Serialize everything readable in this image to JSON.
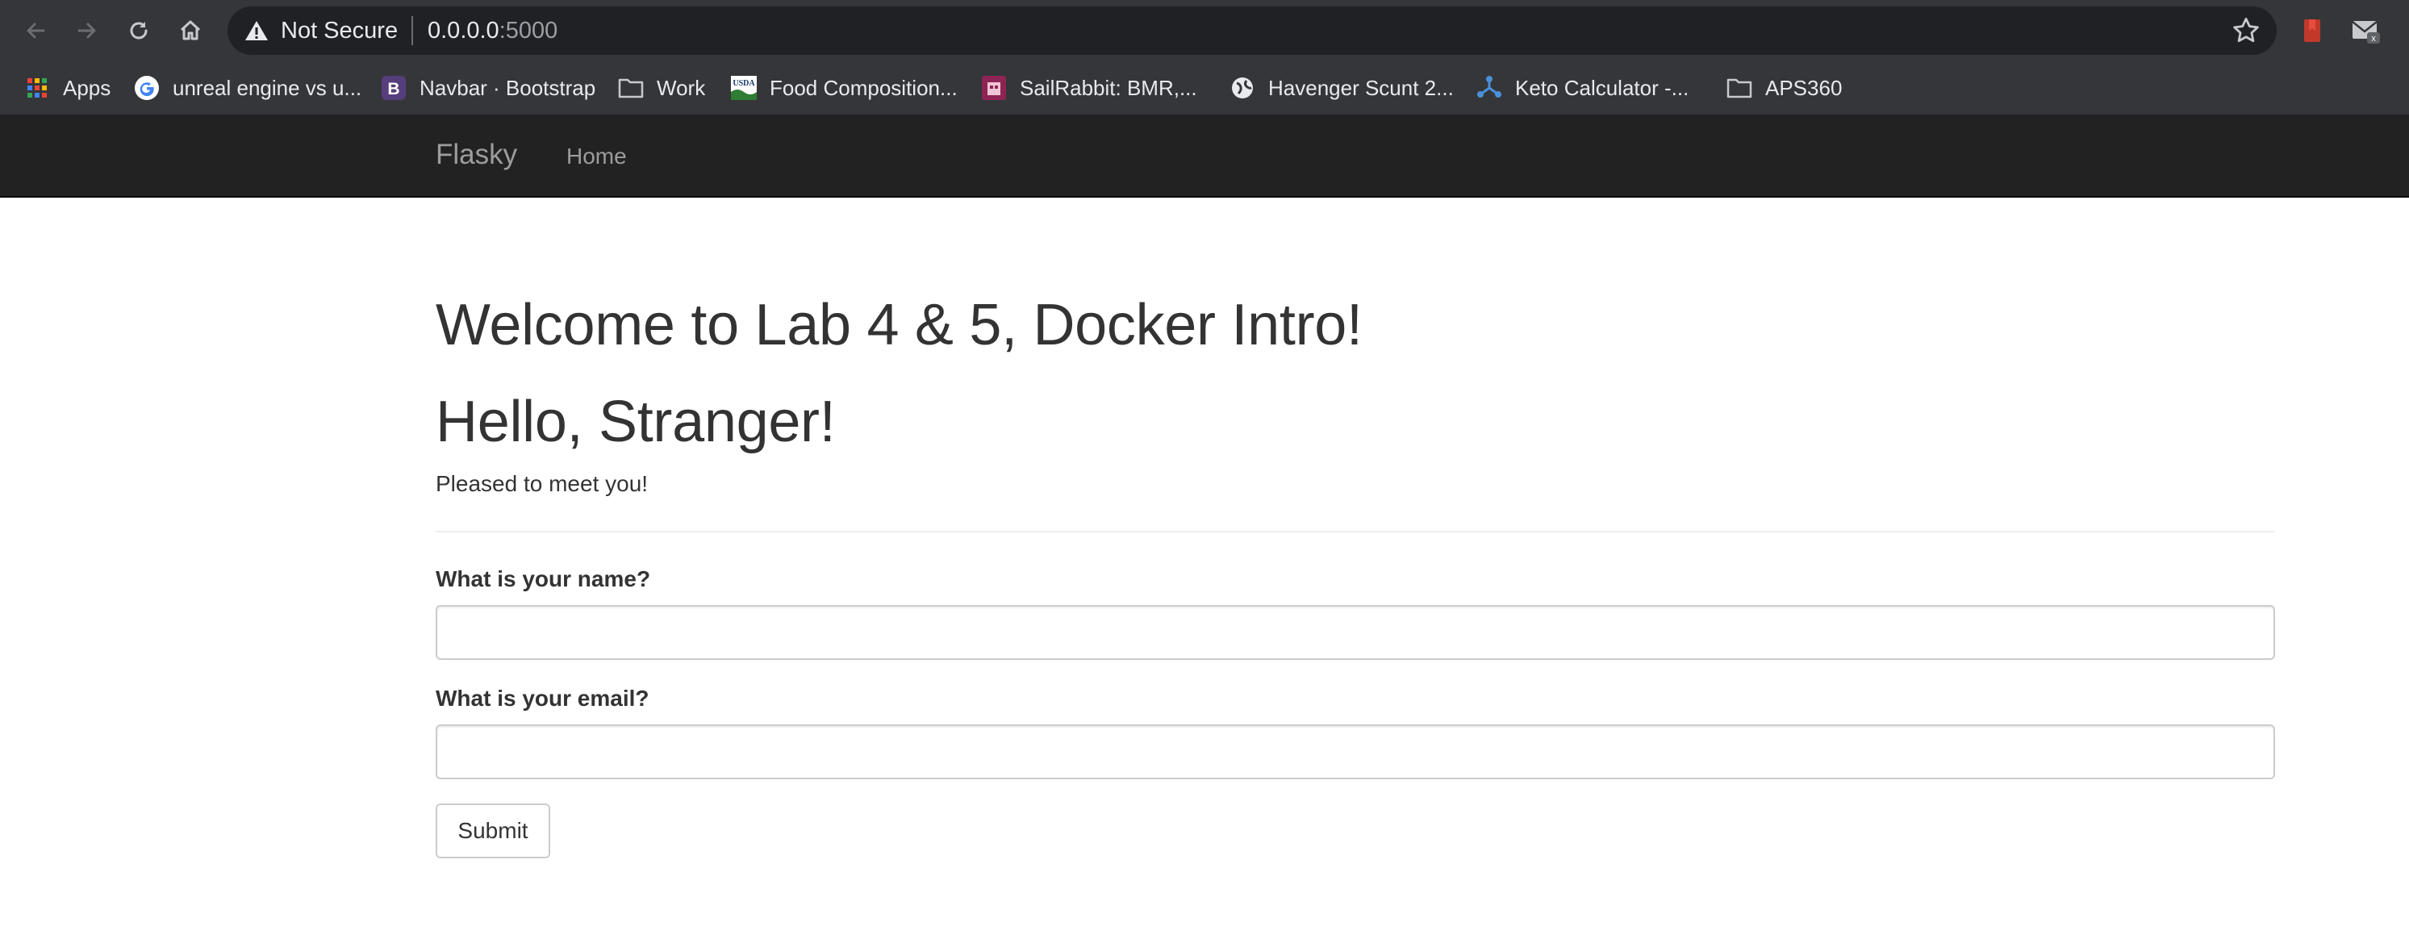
{
  "browser": {
    "security_label": "Not Secure",
    "url_host": "0.0.0.0",
    "url_port": ":5000",
    "bookmarks": [
      {
        "label": "Apps",
        "icon": "apps-grid-icon"
      },
      {
        "label": "unreal engine vs u...",
        "icon": "google-icon"
      },
      {
        "label": "Navbar · Bootstrap",
        "icon": "bootstrap-icon"
      },
      {
        "label": "Work",
        "icon": "folder-icon"
      },
      {
        "label": "Food Composition...",
        "icon": "usda-icon"
      },
      {
        "label": "SailRabbit: BMR,...",
        "icon": "sailrabbit-icon"
      },
      {
        "label": "Havenger Scunt 2...",
        "icon": "globe-icon"
      },
      {
        "label": "Keto Calculator -...",
        "icon": "keto-icon"
      },
      {
        "label": "APS360",
        "icon": "folder-icon"
      }
    ]
  },
  "navbar": {
    "brand": "Flasky",
    "home": "Home"
  },
  "main": {
    "heading": "Welcome to Lab 4 & 5, Docker Intro!",
    "greeting": "Hello, Stranger!",
    "lead": "Pleased to meet you!"
  },
  "form": {
    "name_label": "What is your name?",
    "name_value": "",
    "email_label": "What is your email?",
    "email_value": "",
    "submit_label": "Submit"
  },
  "colors": {
    "chrome_bg": "#35363a",
    "omnibox_bg": "#202124",
    "navbar_bg": "#222222",
    "navbar_text": "#9d9d9d",
    "text": "#333333"
  }
}
